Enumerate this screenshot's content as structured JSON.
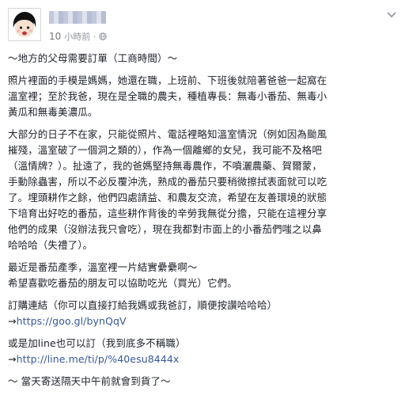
{
  "post": {
    "author_name": "",
    "timestamp_number": "10",
    "timestamp_text": "小時前 ·",
    "paragraphs": [
      {
        "lines": [
          "～地方的父母需要訂單（工商時間）～"
        ]
      },
      {
        "lines": [
          "照片裡面的手模是媽媽，她還在職，上班前、下班後就陪著爸爸一起窩在",
          "溫室裡；至於我爸，現在是全職的農夫，種植專長：無毒小番茄、無毒小",
          "黃瓜和無毒美濃瓜。"
        ]
      },
      {
        "lines": [
          "大部分的日子不在家，只能從照片、電話裡略知溫室情況（例如因為颱風",
          "摧殘，溫室破了一個洞之類的），作為一個離鄉的女兒，我可能不及格吧",
          "（溫情牌？）。扯遠了，我的爸媽堅持無毒農作，不噴灑農藥、賀爾蒙，",
          "手動除蟲害，所以不必反覆沖洗，熟成的番茄只要稍微擦拭表面就可以吃",
          "了。埋頭耕作之餘，他們四處請益、和農友交流，希望在友善環境的狀態",
          "下培育出好吃的番茄，這些耕作背後的辛勞我無從分擔，只能在這裡分享",
          "他們的成果（沒辦法我只會吃），現在我都對市面上的小番茄們嗤之以鼻",
          "哈哈哈（失禮了）。"
        ]
      },
      {
        "lines": [
          "最近是番茄產季，溫室裡一片結實纍纍啊～",
          "希望喜歡吃番茄的朋友可以協助吃光（買光）它們。"
        ]
      },
      {
        "lines": [
          "訂購連結（你可以直接打給我媽或我爸訂，順便按讚哈哈哈）"
        ],
        "link_prefix": "→",
        "link_text": "https://goo.gl/bynQqV"
      },
      {
        "lines": [
          "或是加line也可以訂（我到底多不稱職）"
        ],
        "link_prefix": "→",
        "link_text": "http://line.me/ti/p/%40esu8444x"
      },
      {
        "lines": [
          "～ 當天寄送隔天中午前就會到貨了～"
        ]
      }
    ]
  },
  "icons": {
    "avatar": "cartoon-face-avatar",
    "globe": "globe-icon",
    "menu": "chevron-down-icon"
  },
  "colors": {
    "link": "#365899",
    "meta": "#90949c",
    "text": "#1d2129"
  }
}
